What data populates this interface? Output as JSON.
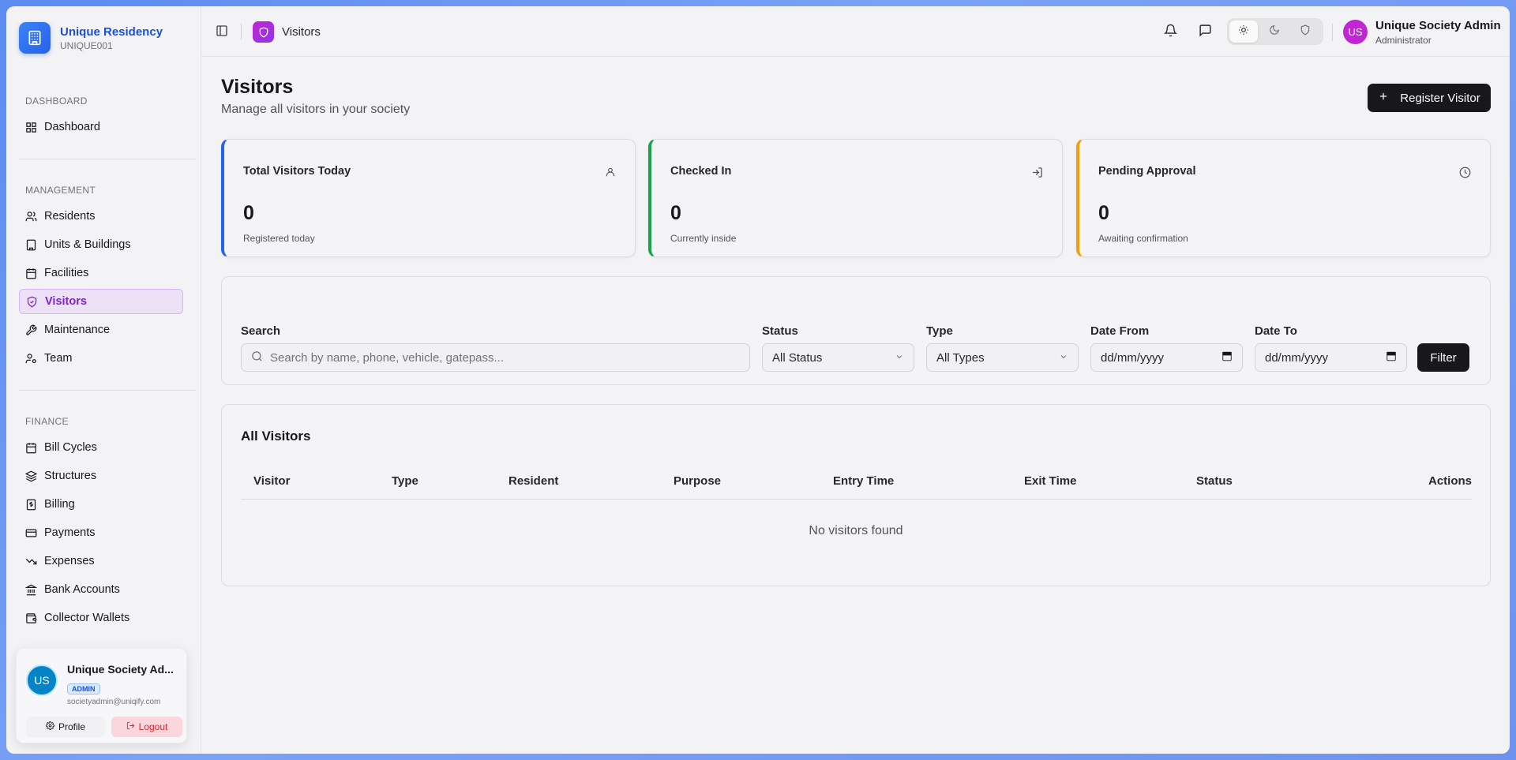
{
  "brand": {
    "name": "Unique Residency",
    "code": "UNIQUE001"
  },
  "sidebar": {
    "sections": [
      {
        "heading": "DASHBOARD",
        "items": [
          {
            "label": "Dashboard",
            "icon": "grid-icon"
          }
        ]
      },
      {
        "heading": "MANAGEMENT",
        "items": [
          {
            "label": "Residents",
            "icon": "users-icon"
          },
          {
            "label": "Units & Buildings",
            "icon": "building-icon"
          },
          {
            "label": "Facilities",
            "icon": "calendar-icon"
          },
          {
            "label": "Visitors",
            "icon": "shield-icon",
            "active": true
          },
          {
            "label": "Maintenance",
            "icon": "wrench-icon"
          },
          {
            "label": "Team",
            "icon": "user-cog-icon"
          }
        ]
      },
      {
        "heading": "FINANCE",
        "items": [
          {
            "label": "Bill Cycles",
            "icon": "calendar-icon"
          },
          {
            "label": "Structures",
            "icon": "layers-icon"
          },
          {
            "label": "Billing",
            "icon": "receipt-icon"
          },
          {
            "label": "Payments",
            "icon": "credit-card-icon"
          },
          {
            "label": "Expenses",
            "icon": "trending-down-icon"
          },
          {
            "label": "Bank Accounts",
            "icon": "bank-icon"
          },
          {
            "label": "Collector Wallets",
            "icon": "wallet-icon"
          }
        ]
      }
    ]
  },
  "user_card": {
    "initials": "US",
    "name": "Unique Society Ad...",
    "badge": "ADMIN",
    "email": "societyadmin@uniqify.com",
    "profile_label": "Profile",
    "logout_label": "Logout"
  },
  "topbar": {
    "breadcrumb": "Visitors",
    "user_initials": "US",
    "user_name": "Unique Society Admin",
    "user_role": "Administrator"
  },
  "page": {
    "title": "Visitors",
    "subtitle": "Manage all visitors in your society",
    "register_label": "Register Visitor"
  },
  "stats": [
    {
      "title": "Total Visitors Today",
      "value": "0",
      "caption": "Registered today",
      "color": "#2563eb",
      "icon": "user-icon"
    },
    {
      "title": "Checked In",
      "value": "0",
      "caption": "Currently inside",
      "color": "#16a34a",
      "icon": "log-in-icon"
    },
    {
      "title": "Pending Approval",
      "value": "0",
      "caption": "Awaiting confirmation",
      "color": "#f59e0b",
      "icon": "clock-icon"
    }
  ],
  "filters": {
    "search_label": "Search",
    "search_placeholder": "Search by name, phone, vehicle, gatepass...",
    "status_label": "Status",
    "status_value": "All Status",
    "type_label": "Type",
    "type_value": "All Types",
    "date_from_label": "Date From",
    "date_from_value": "dd/mm/yyyy",
    "date_to_label": "Date To",
    "date_to_value": "dd/mm/yyyy",
    "filter_label": "Filter"
  },
  "table": {
    "title": "All Visitors",
    "columns": [
      "Visitor",
      "Type",
      "Resident",
      "Purpose",
      "Entry Time",
      "Exit Time",
      "Status",
      "Actions"
    ],
    "empty_text": "No visitors found"
  }
}
